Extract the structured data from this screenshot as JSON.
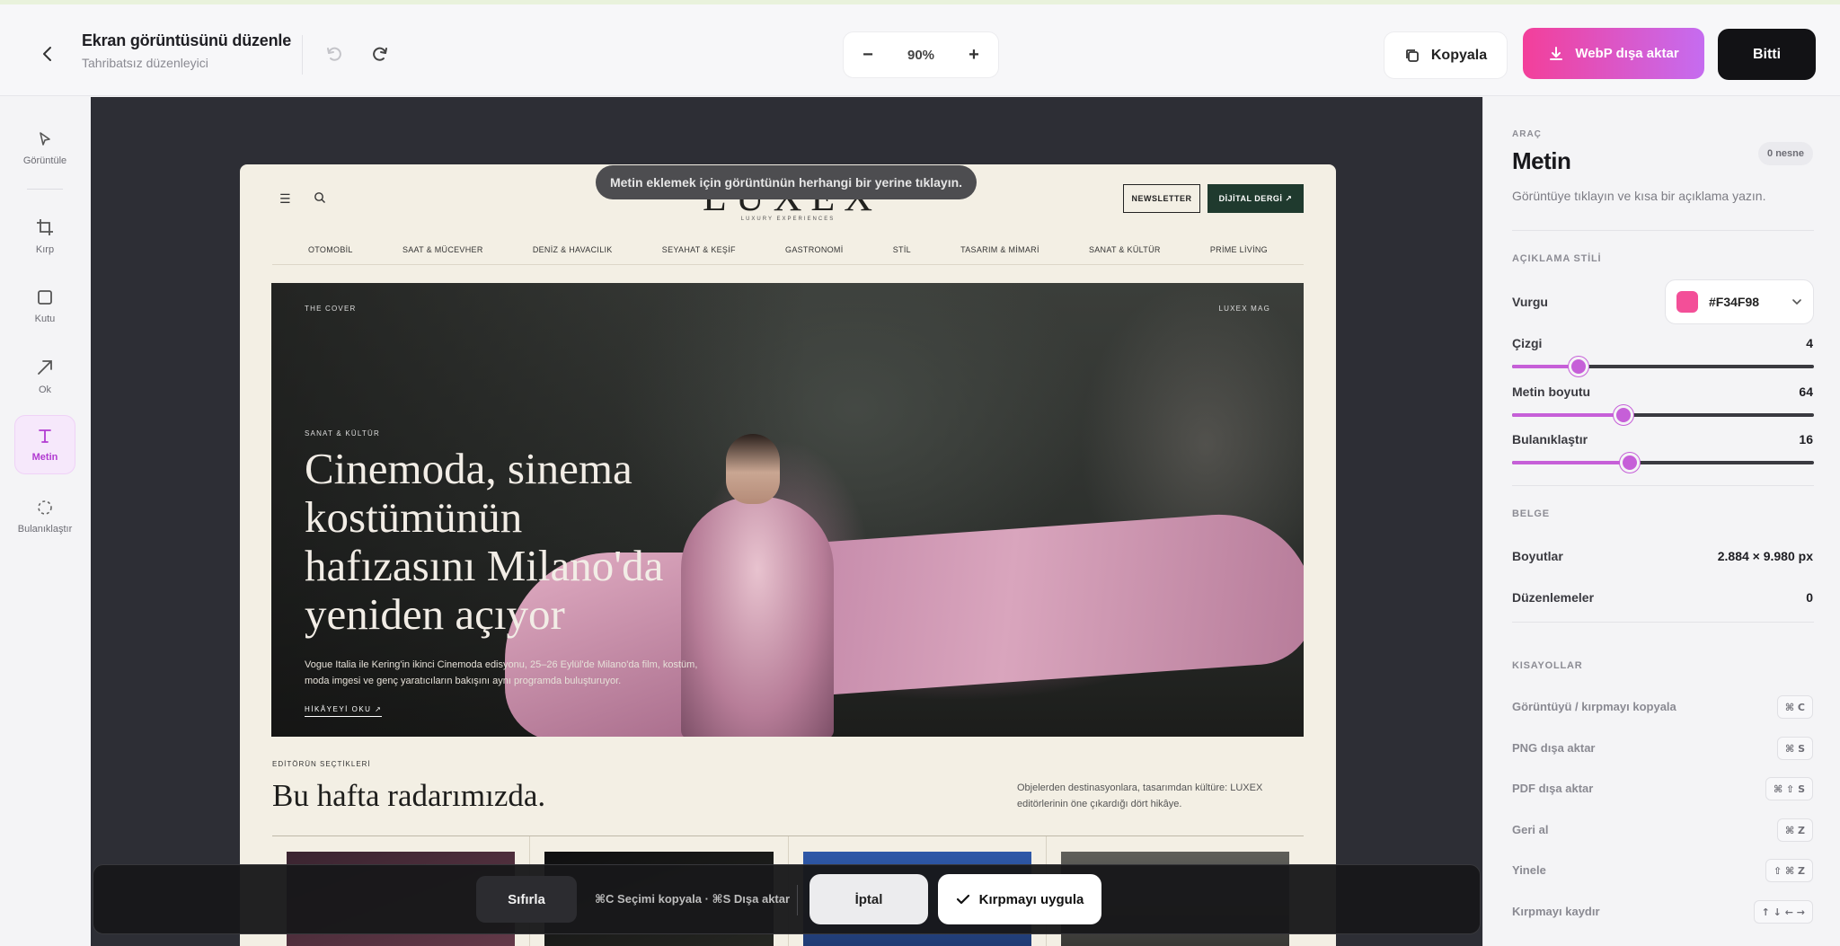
{
  "header": {
    "title": "Ekran görüntüsünü düzenle",
    "subtitle": "Tahribatsız düzenleyici",
    "zoom": "90%",
    "zoom_out": "−",
    "zoom_in": "+",
    "copy_label": "Kopyala",
    "export_label": "WebP dışa aktar",
    "done_label": "Bitti",
    "accent_gradient": [
      "#F33F9A",
      "#C56CF0"
    ]
  },
  "tools": [
    {
      "label": "Görüntüle",
      "icon": "pointer-icon"
    },
    {
      "label": "Kırp",
      "icon": "crop-icon"
    },
    {
      "label": "Kutu",
      "icon": "box-icon"
    },
    {
      "label": "Ok",
      "icon": "arrow-icon"
    },
    {
      "label": "Metin",
      "icon": "text-icon",
      "active": true
    },
    {
      "label": "Bulanıklaştır",
      "icon": "blur-icon"
    }
  ],
  "canvas": {
    "hint": "Metin eklemek için görüntünün herhangi bir yerine tıklayın.",
    "site": {
      "logo": "LUXEX",
      "tagline": "LUXURY EXPERIENCES",
      "newsletter": "NEWSLETTER",
      "digital": "DİJİTAL DERGİ ↗",
      "nav": [
        "OTOMOBİL",
        "SAAT & MÜCEVHER",
        "DENİZ & HAVACILIK",
        "SEYAHAT & KEŞİF",
        "GASTRONOMİ",
        "STİL",
        "TASARIM & MİMARİ",
        "SANAT & KÜLTÜR",
        "PRİME LİVİNG"
      ],
      "hero": {
        "cover": "THE COVER",
        "mag": "LUXEX MAG",
        "category": "SANAT & KÜLTÜR",
        "title": "Cinemoda, sinema kostümünün hafızasını Milano'da yeniden açıyor",
        "description": "Vogue Italia ile Kering'in ikinci Cinemoda edisyonu, 25–26 Eylül'de Milano'da film, kostüm, moda imgesi ve genç yaratıcıların bakışını aynı programda buluşturuyor.",
        "cta": "HİKÂYEYİ OKU ↗"
      },
      "editor": {
        "label": "EDİTÖRÜN SEÇTİKLERİ",
        "title": "Bu hafta radarımızda.",
        "description": "Objelerden destinasyonlara, tasarımdan kültüre: LUXEX editörlerinin öne çıkardığı dört hikâye."
      }
    }
  },
  "bottombar": {
    "reset": "Sıfırla",
    "hint": "⌘C Seçimi kopyala · ⌘S Dışa aktar",
    "cancel": "İptal",
    "apply": "Kırpmayı uygula"
  },
  "panel": {
    "tool_label": "ARAÇ",
    "tool_name": "Metin",
    "object_count": "0 nesne",
    "description": "Görüntüye tıklayın ve kısa bir açıklama yazın.",
    "style_label": "AÇIKLAMA STİLİ",
    "accent_label": "Vurgu",
    "accent_color": "#F34F98",
    "accent_hex": "#F34F98",
    "sliders": [
      {
        "label": "Çizgi",
        "value": "4",
        "fraction": 0.22
      },
      {
        "label": "Metin boyutu",
        "value": "64",
        "fraction": 0.37
      },
      {
        "label": "Bulanıklaştır",
        "value": "16",
        "fraction": 0.39
      }
    ],
    "doc_label": "BELGE",
    "dimensions_label": "Boyutlar",
    "dimensions_value": "2.884 × 9.980 px",
    "edits_label": "Düzenlemeler",
    "edits_value": "0",
    "shortcuts_label": "KISAYOLLAR",
    "shortcuts": [
      {
        "label": "Görüntüyü / kırpmayı kopyala",
        "key": "⌘ C"
      },
      {
        "label": "PNG dışa aktar",
        "key": "⌘ S"
      },
      {
        "label": "PDF dışa aktar",
        "key": "⌘ ⇧ S"
      },
      {
        "label": "Geri al",
        "key": "⌘ Z"
      },
      {
        "label": "Yinele",
        "key": "⇧ ⌘ Z"
      },
      {
        "label": "Kırpmayı kaydır",
        "key": "↑ ↓ ← →"
      }
    ]
  }
}
